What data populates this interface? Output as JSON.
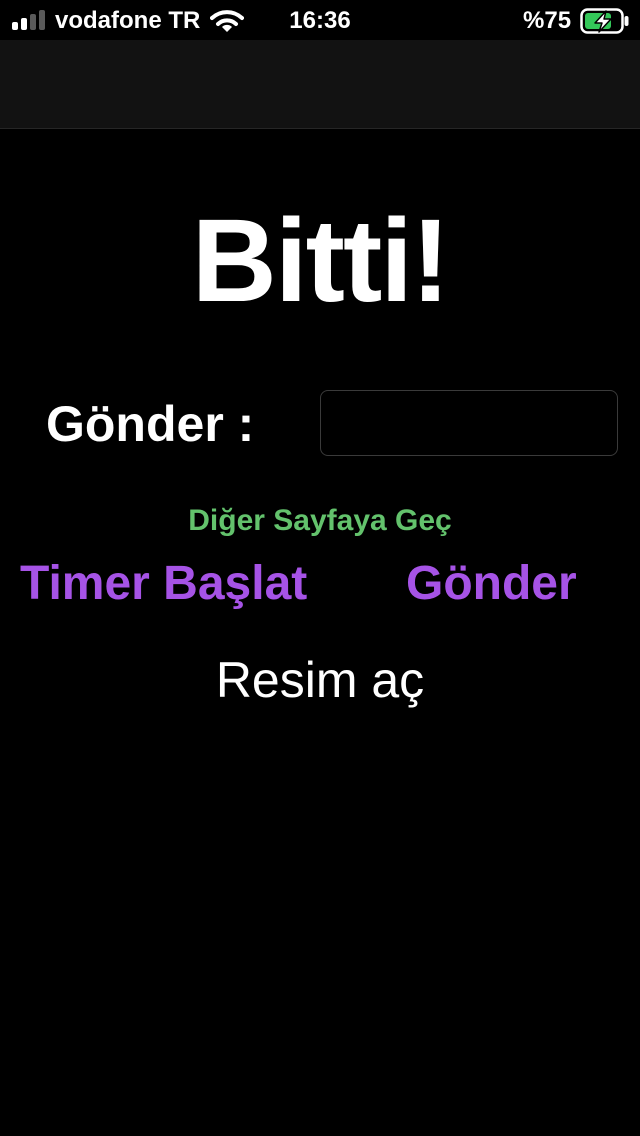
{
  "status_bar": {
    "carrier": "vodafone TR",
    "time": "16:36",
    "battery_percent": "%75",
    "signal_bars": 4,
    "signal_bars_active": 2,
    "icons": [
      "signal-icon",
      "wifi-icon",
      "battery-charging-icon"
    ]
  },
  "main": {
    "title": "Bitti!",
    "send_label": "Gönder :",
    "send_input_value": "",
    "next_page_label": "Diğer Sayfaya Geç",
    "timer_start_label": "Timer Başlat",
    "send_button_label": "Gönder",
    "open_image_label": "Resim aç"
  },
  "colors": {
    "background": "#000000",
    "nav_bar": "#121212",
    "green_link": "#63c26c",
    "purple_button": "#a653e6",
    "battery_charging": "#34c759"
  }
}
